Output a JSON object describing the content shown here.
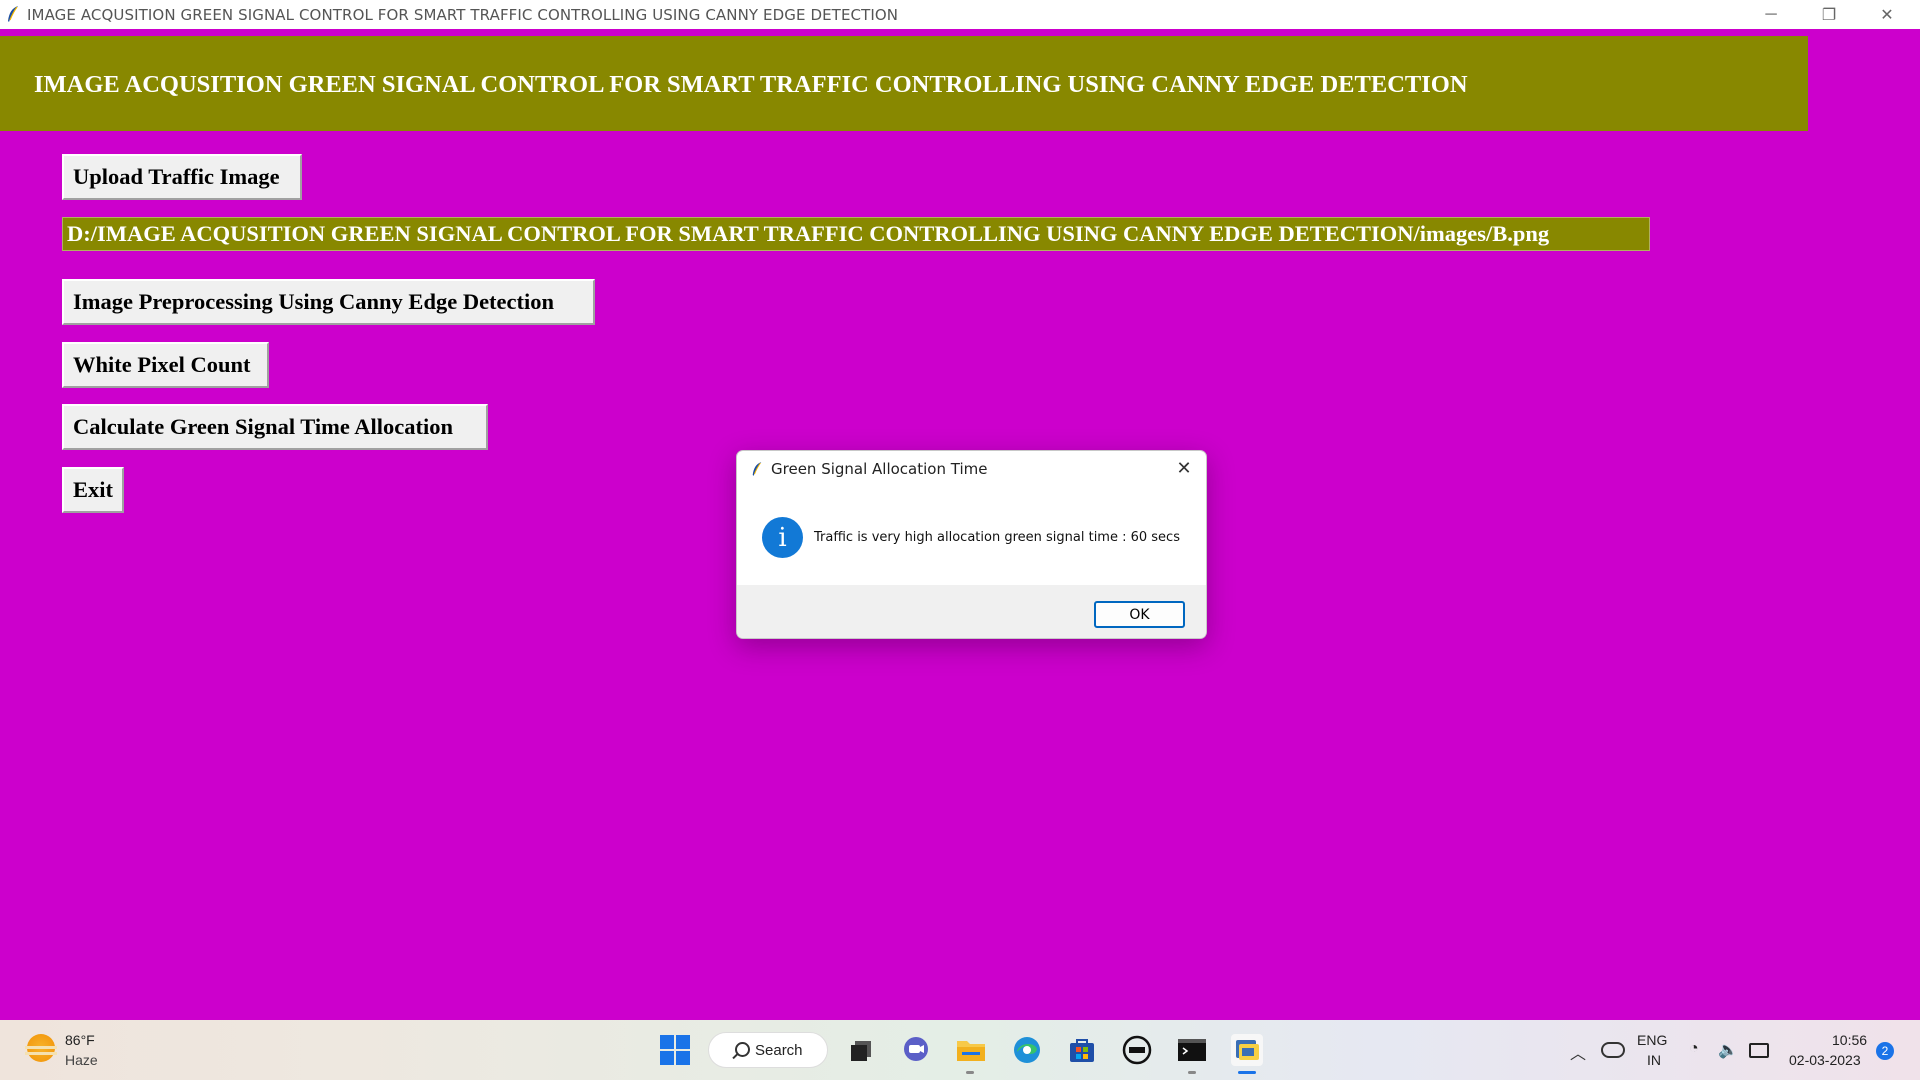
{
  "window": {
    "title": "IMAGE ACQUSITION GREEN SIGNAL CONTROL FOR SMART TRAFFIC CONTROLLING USING CANNY EDGE DETECTION",
    "min_glyph": "─",
    "max_glyph": "❐",
    "close_glyph": "✕"
  },
  "header": {
    "title": "IMAGE ACQUSITION GREEN SIGNAL CONTROL FOR SMART TRAFFIC CONTROLLING USING CANNY EDGE DETECTION",
    "bg_color": "#888800"
  },
  "buttons": {
    "upload": "Upload Traffic Image",
    "preprocess": "Image Preprocessing Using Canny Edge Detection",
    "pixel_count": "White Pixel Count",
    "calculate": "Calculate Green Signal Time Allocation",
    "exit": "Exit"
  },
  "path_label": "D:/IMAGE ACQUSITION GREEN SIGNAL CONTROL FOR SMART TRAFFIC CONTROLLING USING CANNY EDGE DETECTION/images/B.png",
  "dialog": {
    "title": "Green Signal Allocation Time",
    "message": "Traffic is very high allocation green signal time : 60 secs",
    "info_glyph": "i",
    "close_glyph": "✕",
    "ok_label": "OK"
  },
  "taskbar": {
    "weather_temp": "86°F",
    "weather_cond": "Haze",
    "search_label": "Search",
    "lang_line1": "ENG",
    "lang_line2": "IN",
    "time": "10:56",
    "date": "02-03-2023",
    "notification_count": "2",
    "tray_up_glyph": "︿",
    "wifi_glyph": "◔",
    "vol_glyph": "🔈"
  },
  "colors": {
    "background": "#cc00cc",
    "banner": "#888800",
    "dialog_accent": "#0067c0"
  },
  "icons": [
    "feather-icon",
    "search-icon",
    "windows-start-icon",
    "task-view-icon",
    "chat-icon",
    "file-explorer-icon",
    "edge-icon",
    "store-icon",
    "dell-icon",
    "terminal-icon",
    "python-icon",
    "wifi-icon",
    "volume-icon",
    "battery-icon",
    "cloud-icon"
  ]
}
